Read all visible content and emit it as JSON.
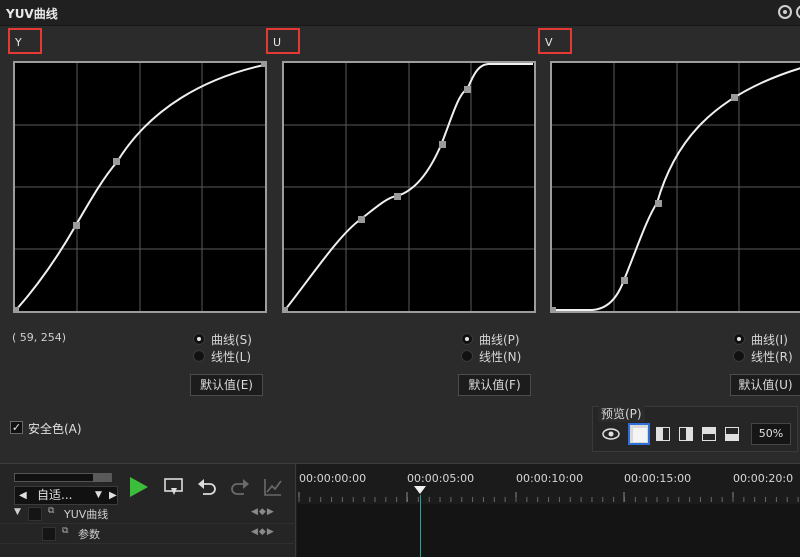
{
  "window": {
    "title": "YUV曲线"
  },
  "channels": [
    {
      "label": "Y",
      "radio_curve": "曲线(S)",
      "radio_linear": "线性(L)",
      "default_button": "默认值(E)"
    },
    {
      "label": "U",
      "radio_curve": "曲线(P)",
      "radio_linear": "线性(N)",
      "default_button": "默认值(F)"
    },
    {
      "label": "V",
      "radio_curve": "曲线(I)",
      "radio_linear": "线性(R)",
      "default_button": "默认值(U)"
    }
  ],
  "coordinates": "( 59, 254)",
  "safe_color": {
    "label": "安全色(A)",
    "checked": true,
    "check_glyph": "✓"
  },
  "preview": {
    "label": "预览(P)",
    "zoom": "50%"
  },
  "timeline": {
    "view_select": {
      "value": "自适...",
      "arrow_left": "◀",
      "arrow_right": "▶",
      "dropdown": "▼"
    },
    "timecodes": [
      "00:00:00:00",
      "00:00:05:00",
      "00:00:10:00",
      "00:00:15:00",
      "00:00:20:0"
    ],
    "tracks": [
      {
        "name": "YUV曲线",
        "expand": "▼",
        "keyframe_nav": "◀◆▶"
      },
      {
        "name": "参数",
        "expand": "",
        "keyframe_nav": "◀◆▶"
      }
    ]
  },
  "colors": {
    "accent_red": "#e53935",
    "play_green": "#3bbf3b",
    "selection_blue": "#2f6fd8",
    "playhead": "#1fa99b"
  }
}
